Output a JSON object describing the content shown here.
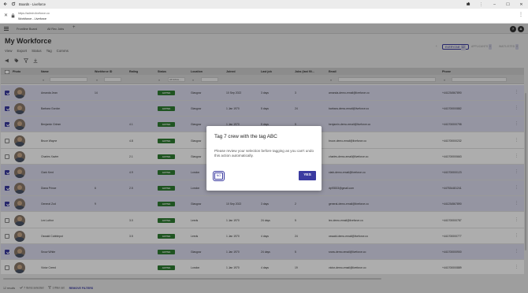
{
  "browser": {
    "tab_title": "Boards - Liveforce",
    "url": "https://admin.liveforce.co",
    "page_title": "Workforce - Liveforce"
  },
  "app": {
    "tabs": [
      "Frontline Board",
      "All Rec Jobs"
    ],
    "avatars": [
      "?",
      "A"
    ]
  },
  "page": {
    "title": "My Workforce",
    "menu": [
      "View",
      "Export",
      "Status",
      "Tag",
      "Comms"
    ],
    "filters": [
      {
        "label": "EVERYONE",
        "count": "12",
        "active": true
      },
      {
        "label": "APPLICANTS",
        "count": "0",
        "active": false
      },
      {
        "label": "WAITLISTED",
        "count": "0",
        "active": false
      }
    ]
  },
  "table": {
    "headers": [
      "Photo",
      "Name",
      "Workforce ID",
      "Rating",
      "Status",
      "Location",
      "Joined",
      "Last job",
      "Jobs (last 90...",
      "Email",
      "Phone"
    ],
    "status_filter_placeholder": "All Active...",
    "rows": [
      {
        "selected": true,
        "name": "Amanda Jean",
        "wid": "14",
        "rating": "",
        "status": "ACTIVE",
        "location": "Glasgow",
        "joined": "10 Sep 2022",
        "last_job": "3 days",
        "jobs": "3",
        "email": "amanda-demo-email@liveforce.co",
        "phone": "+441234567890"
      },
      {
        "selected": true,
        "name": "Barbara Gordon",
        "wid": "",
        "rating": "",
        "status": "ACTIVE",
        "location": "Glasgow",
        "joined": "1 Jan 1970",
        "last_job": "5 days",
        "jobs": "24",
        "email": "barbara-demo-email@liveforce.co",
        "phone": "+441700000882"
      },
      {
        "selected": true,
        "name": "Benjamin Grimm",
        "wid": "",
        "rating": "4.1",
        "status": "ACTIVE",
        "location": "Glasgow",
        "joined": "1 Jan 1970",
        "last_job": "5 days",
        "jobs": "5",
        "email": "benjamin-demo-email@liveforce.co",
        "phone": "+441700000798"
      },
      {
        "selected": false,
        "name": "Bruce Wayne",
        "wid": "",
        "rating": "4.8",
        "status": "ACTIVE",
        "location": "Glasgow",
        "joined": "1 Jan 1970",
        "last_job": "5 days",
        "jobs": "6",
        "email": "bruce-demo-email@liveforce.co",
        "phone": "+441700000232"
      },
      {
        "selected": false,
        "name": "Charles Xavier",
        "wid": "",
        "rating": "2.1",
        "status": "ACTIVE",
        "location": "Glasgow",
        "joined": "1 Jan 1970",
        "last_job": "3 days",
        "jobs": "3",
        "email": "charles-demo-email@liveforce.co",
        "phone": "+441700000663"
      },
      {
        "selected": true,
        "name": "Clark Kent",
        "wid": "",
        "rating": "4.9",
        "status": "ACTIVE",
        "location": "London",
        "joined": "1 Jan 1970",
        "last_job": "4 days",
        "jobs": "13",
        "email": "clark-demo-email@liveforce.co",
        "phone": "+441700000123"
      },
      {
        "selected": true,
        "name": "Diana Prince",
        "wid": "6",
        "rating": "2.5",
        "status": "ACTIVE",
        "location": "London",
        "joined": "1 Jan 1970",
        "last_job": "4 days",
        "jobs": "12",
        "email": "dp93533@gmail.com",
        "phone": "+447534481241"
      },
      {
        "selected": true,
        "name": "General Zod",
        "wid": "9",
        "rating": "",
        "status": "ACTIVE",
        "location": "Glasgow",
        "joined": "10 Sep 2022",
        "last_job": "3 days",
        "jobs": "2",
        "email": "general-demo-email@liveforce.co",
        "phone": "+441234567890"
      },
      {
        "selected": false,
        "name": "Lex Luthor",
        "wid": "",
        "rating": "3.0",
        "status": "ACTIVE",
        "location": "Leeds",
        "joined": "1 Jan 1970",
        "last_job": "24 days",
        "jobs": "5",
        "email": "lex-demo-email@liveforce.co",
        "phone": "+441700000787"
      },
      {
        "selected": false,
        "name": "Oswald Cobblepot",
        "wid": "",
        "rating": "3.5",
        "status": "ACTIVE",
        "location": "Leeds",
        "joined": "1 Jan 1970",
        "last_job": "4 days",
        "jobs": "24",
        "email": "oswald-demo-email@liveforce.co",
        "phone": "+441700000777"
      },
      {
        "selected": true,
        "name": "Snow White",
        "wid": "",
        "rating": "",
        "status": "ACTIVE",
        "location": "Glasgow",
        "joined": "1 Jan 1970",
        "last_job": "24 days",
        "jobs": "5",
        "email": "snow-demo-email@liveforce.co",
        "phone": "+441700000900"
      },
      {
        "selected": false,
        "name": "Victor Creed",
        "wid": "",
        "rating": "",
        "status": "ACTIVE",
        "location": "London",
        "joined": "1 Jan 1970",
        "last_job": "4 days",
        "jobs": "19",
        "email": "victor-demo-email@liveforce.co",
        "phone": "+441700000889"
      }
    ]
  },
  "footer": {
    "results": "12 results",
    "selected": "7 items selected",
    "filter": "1 filter set",
    "remove": "REMOVE FILTERS"
  },
  "modal": {
    "title": "Tag 7 crew with the tag ABC",
    "body": "Please review your selection before tagging as you can't undo this action automatically.",
    "no_label": "NO",
    "yes_label": "YES"
  },
  "colors": {
    "accent": "#3a3aa0",
    "active_badge": "#2e7d32",
    "selected_row": "#dcdcef"
  }
}
